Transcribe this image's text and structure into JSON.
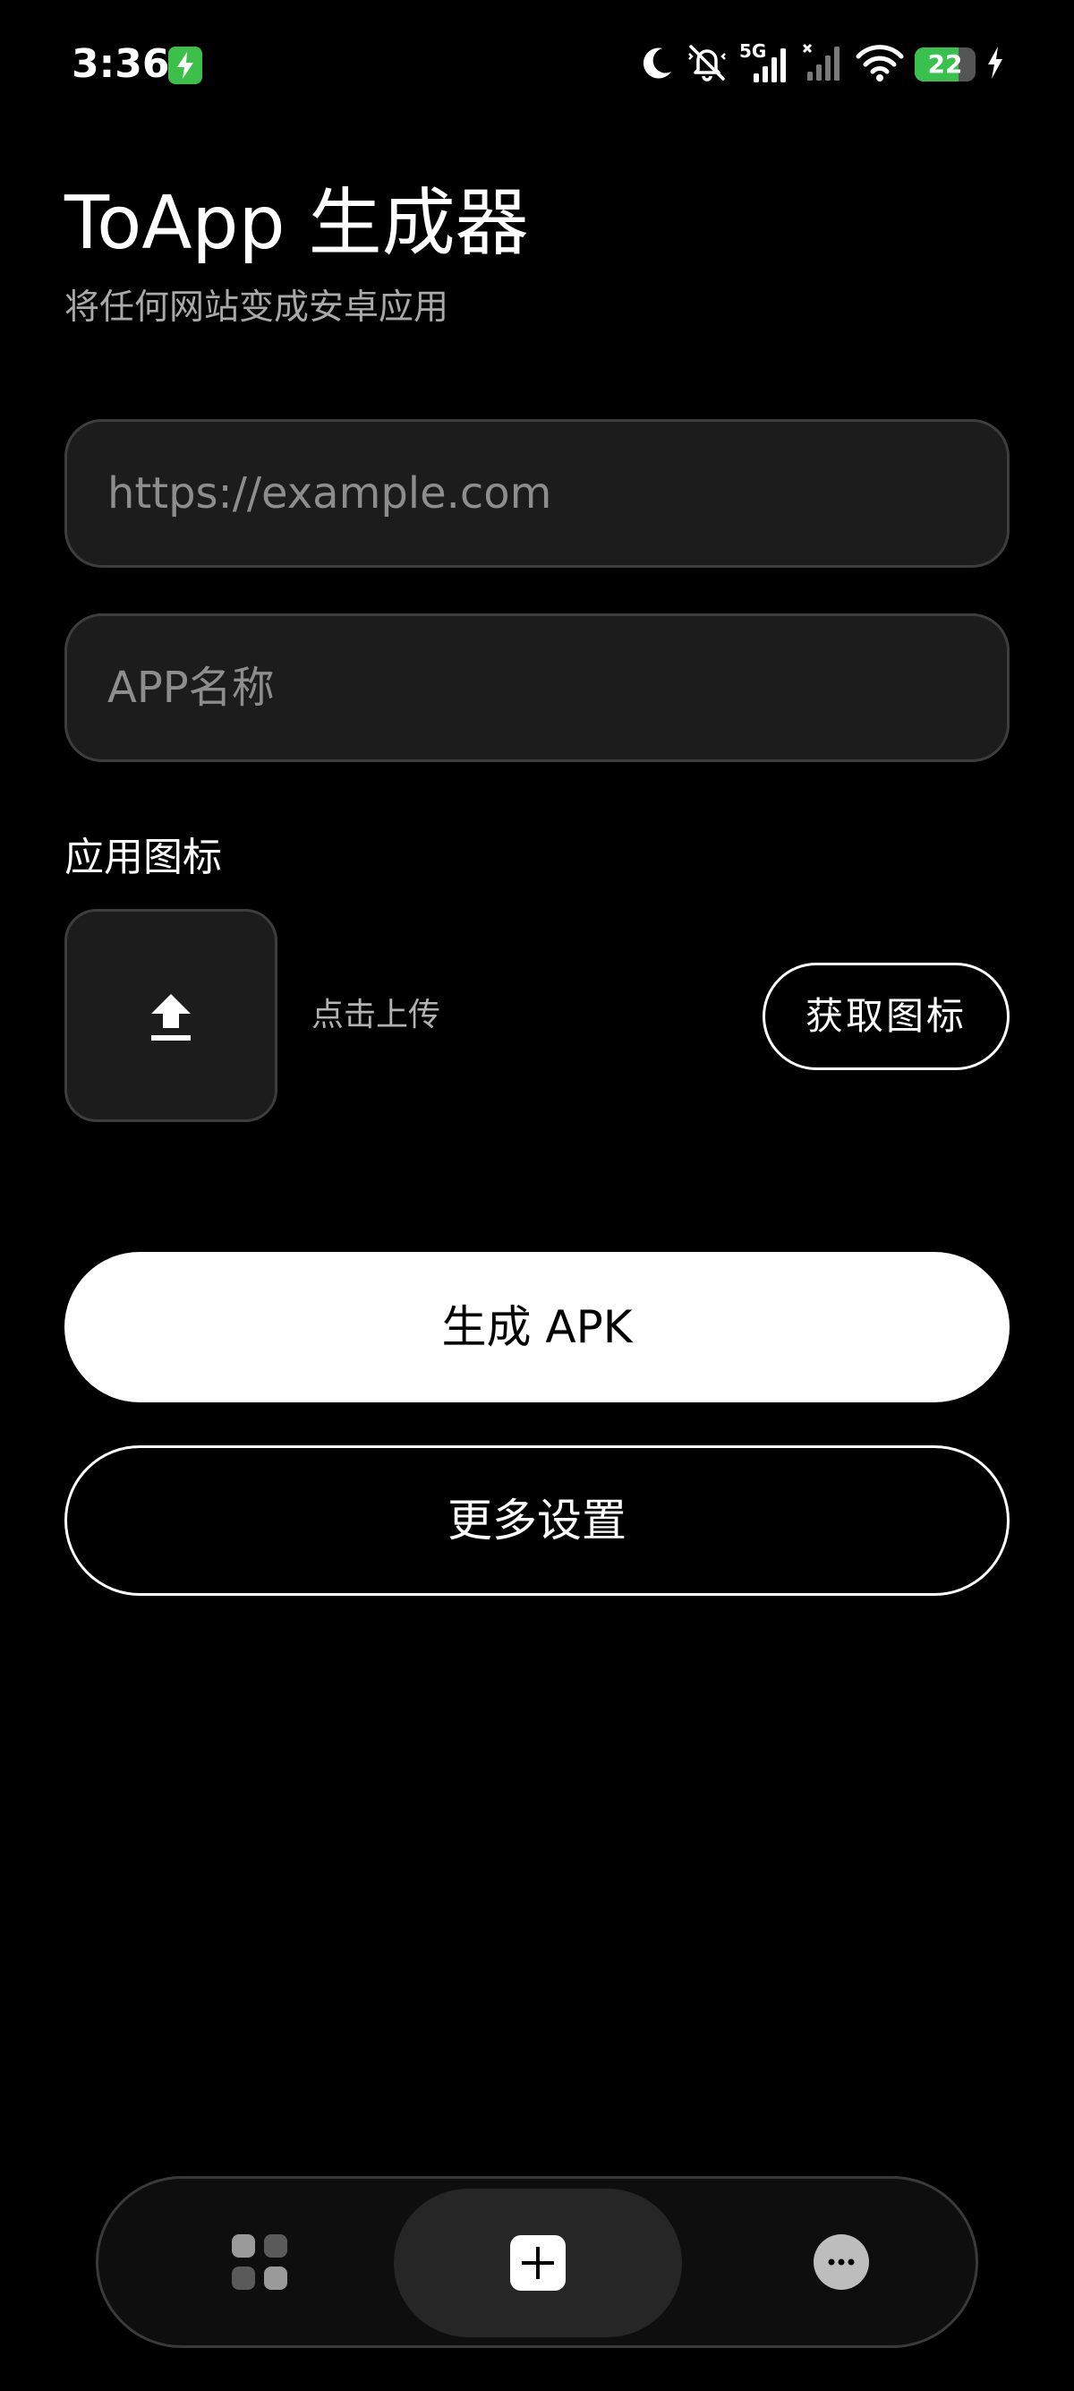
{
  "status_bar": {
    "time": "3:36",
    "network_label": "5G",
    "battery_level": 22,
    "icons": [
      "charging-notification-icon",
      "moon-icon",
      "mute-icon",
      "signal-5g-icon",
      "signal-no-service-icon",
      "wifi-icon",
      "battery-icon",
      "charging-bolt-icon"
    ]
  },
  "header": {
    "title": "ToApp 生成器",
    "subtitle": "将任何网站变成安卓应用"
  },
  "form": {
    "url_placeholder": "https://example.com",
    "url_value": "",
    "name_placeholder": "APP名称",
    "name_value": ""
  },
  "icon_section": {
    "label": "应用图标",
    "upload_hint": "点击上传",
    "upload_icon": "upload-icon",
    "fetch_button": "获取图标"
  },
  "actions": {
    "generate_apk": "生成 APK",
    "more_settings": "更多设置"
  },
  "bottom_nav": {
    "items": [
      {
        "icon": "apps-grid-icon",
        "active": false
      },
      {
        "icon": "add-icon",
        "active": true
      },
      {
        "icon": "more-icon",
        "active": false
      }
    ]
  },
  "colors": {
    "background": "#000000",
    "field_background": "#1c1c1c",
    "field_border": "#3d3d3d",
    "primary_button": "#ffffff",
    "subtitle": "#a9a9a9",
    "charging_green": "#3cc04a"
  }
}
